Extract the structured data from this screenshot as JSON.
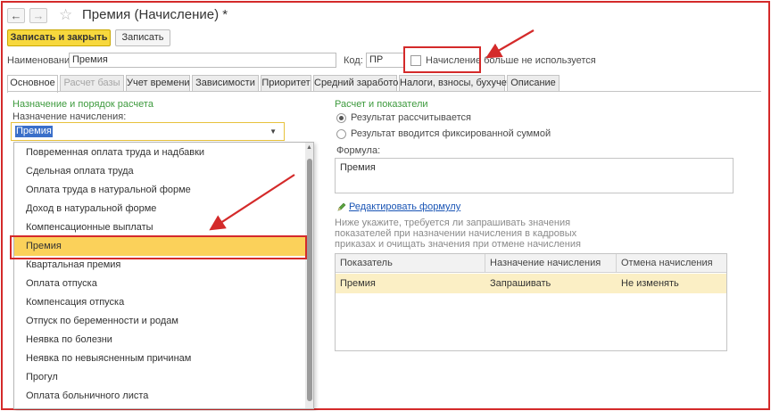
{
  "window": {
    "title": "Премия (Начисление) *",
    "back_icon": "arrow-left-icon",
    "forward_icon": "arrow-right-icon",
    "favorite_icon": "star-icon"
  },
  "toolbar": {
    "save_close_label": "Записать и закрыть",
    "save_label": "Записать"
  },
  "header": {
    "name_label": "Наименование:",
    "name_value": "Премия",
    "code_label": "Код:",
    "code_value": "ПР",
    "unused_label": "Начисление больше не используется",
    "unused_checked": false
  },
  "tabs": [
    {
      "label": "Основное",
      "active": true,
      "disabled": false
    },
    {
      "label": "Расчет базы",
      "active": false,
      "disabled": true
    },
    {
      "label": "Учет времени",
      "active": false,
      "disabled": false
    },
    {
      "label": "Зависимости",
      "active": false,
      "disabled": false
    },
    {
      "label": "Приоритет",
      "active": false,
      "disabled": false
    },
    {
      "label": "Средний заработок",
      "active": false,
      "disabled": false
    },
    {
      "label": "Налоги, взносы, бухучет",
      "active": false,
      "disabled": false
    },
    {
      "label": "Описание",
      "active": false,
      "disabled": false
    }
  ],
  "left": {
    "section_title": "Назначение и порядок расчета",
    "purpose_label": "Назначение начисления:",
    "purpose_value": "Премия",
    "dropdown_items": [
      "Повременная оплата труда и надбавки",
      "Сдельная оплата труда",
      "Оплата труда в натуральной форме",
      "Доход в натуральной форме",
      "Компенсационные выплаты",
      "Премия",
      "Квартальная премия",
      "Оплата отпуска",
      "Компенсация отпуска",
      "Отпуск по беременности и родам",
      "Неявка по болезни",
      "Неявка по невыясненным причинам",
      "Прогул",
      "Оплата больничного листа"
    ],
    "selected_index": 5
  },
  "right": {
    "section_title": "Расчет и показатели",
    "radio_calc": "Результат рассчитывается",
    "radio_fixed": "Результат вводится фиксированной суммой",
    "radio_selected": "calc",
    "formula_label": "Формула:",
    "formula_value": "Премия",
    "edit_formula_link": "Редактировать формулу",
    "hint": "Ниже укажите, требуется ли запрашивать значения показателей при назначении начисления в кадровых приказах и очищать значения при отмене начисления",
    "grid": {
      "columns": [
        "Показатель",
        "Назначение начисления",
        "Отмена начисления"
      ],
      "rows": [
        [
          "Премия",
          "Запрашивать",
          "Не изменять"
        ]
      ]
    }
  },
  "colors": {
    "accent_yellow": "#f7d83d",
    "selection_yellow": "#fbd15a",
    "row_highlight": "#fbefc5",
    "annotation_red": "#d42a2a",
    "section_green": "#3d9a3d",
    "link_blue": "#1a55b5"
  }
}
